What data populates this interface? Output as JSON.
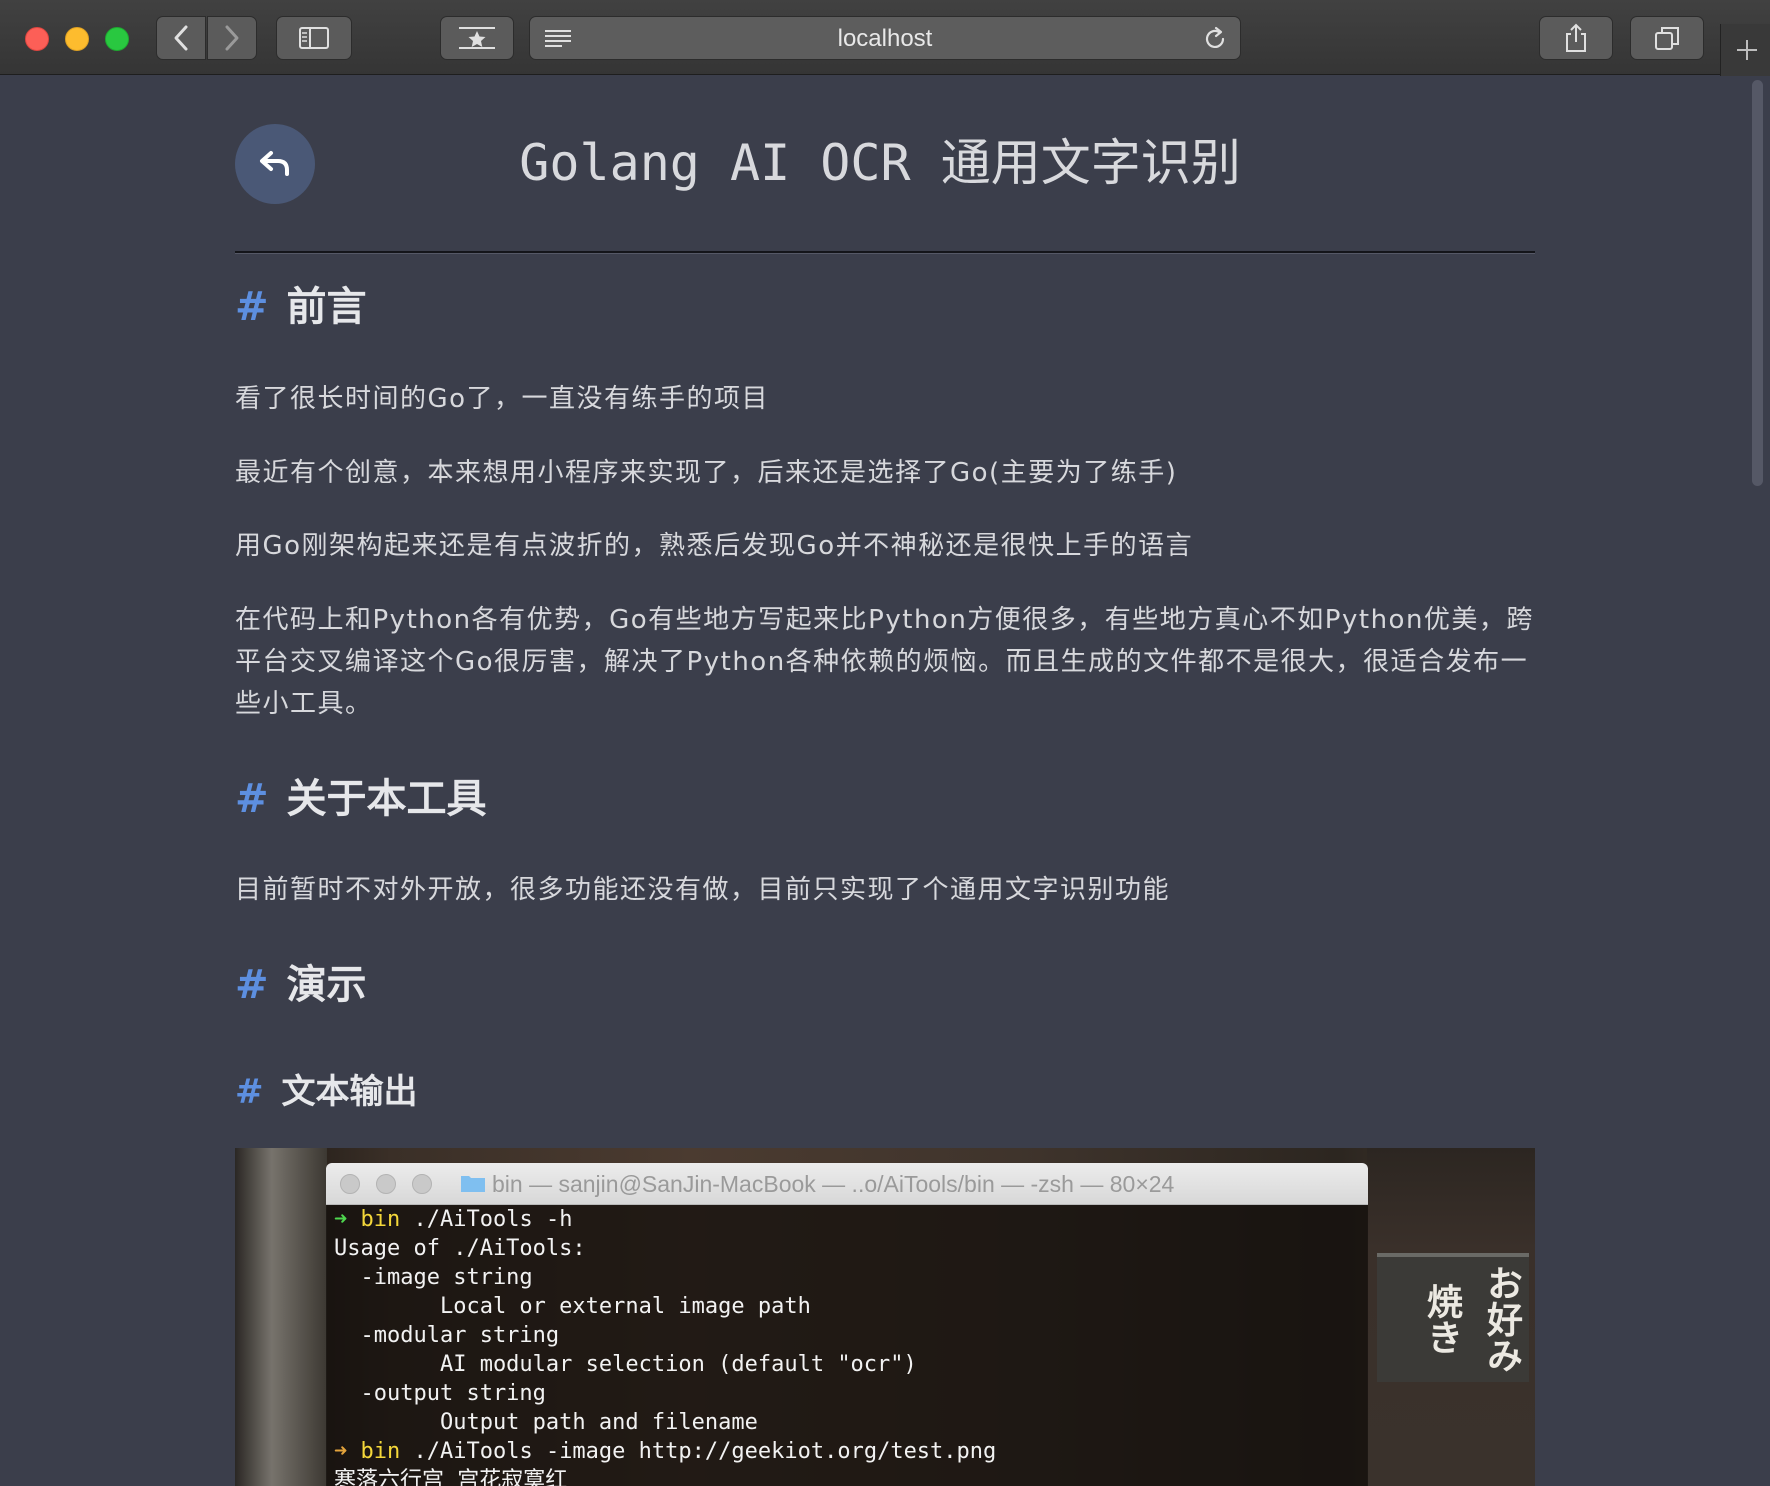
{
  "browser": {
    "url": "localhost",
    "buttons": {
      "back": "back-icon",
      "forward": "forward-icon",
      "sidebar": "sidebar-icon",
      "bookmarks": "bookmark-star-icon",
      "reader": "reader-icon",
      "reload": "reload-icon",
      "share": "share-icon",
      "tabs": "tabs-overview-icon",
      "new_tab": "plus-icon"
    }
  },
  "page": {
    "back_button": "reply-arrow-icon",
    "title": "Golang AI OCR 通用文字识别",
    "sections": [
      {
        "hash": "#",
        "heading": "前言",
        "paragraphs": [
          "看了很长时间的Go了，一直没有练手的项目",
          "最近有个创意，本来想用小程序来实现了，后来还是选择了Go(主要为了练手)",
          "用Go刚架构起来还是有点波折的，熟悉后发现Go并不神秘还是很快上手的语言",
          "在代码上和Python各有优势，Go有些地方写起来比Python方便很多，有些地方真心不如Python优美，跨平台交叉编译这个Go很厉害，解决了Python各种依赖的烦恼。而且生成的文件都不是很大，很适合发布一些小工具。"
        ]
      },
      {
        "hash": "#",
        "heading": "关于本工具",
        "paragraphs": [
          "目前暂时不对外开放，很多功能还没有做，目前只实现了个通用文字识别功能"
        ]
      },
      {
        "hash": "#",
        "heading": "演示"
      },
      {
        "hash": "#",
        "heading": "文本输出"
      }
    ],
    "screenshot": {
      "terminal_title": "bin — sanjin@SanJin-MacBook — ..o/AiTools/bin — -zsh — 80×24",
      "sign_text": [
        "お好み",
        "焼き"
      ],
      "lines": [
        {
          "prompt": "➜",
          "dir": "bin",
          "text": " ./AiTools -h"
        },
        {
          "text": "Usage of ./AiTools:"
        },
        {
          "text": "  -image string"
        },
        {
          "text": "        Local or external image path"
        },
        {
          "text": "  -modular string"
        },
        {
          "text": "        AI modular selection (default \"ocr\")"
        },
        {
          "text": "  -output string"
        },
        {
          "text": "        Output path and filename"
        },
        {
          "prompt": "➜",
          "dir": "bin",
          "text": " ./AiTools -image http://geekiot.org/test.png"
        },
        {
          "text": "寒落六行宫 宫花寂寞红"
        }
      ]
    }
  }
}
